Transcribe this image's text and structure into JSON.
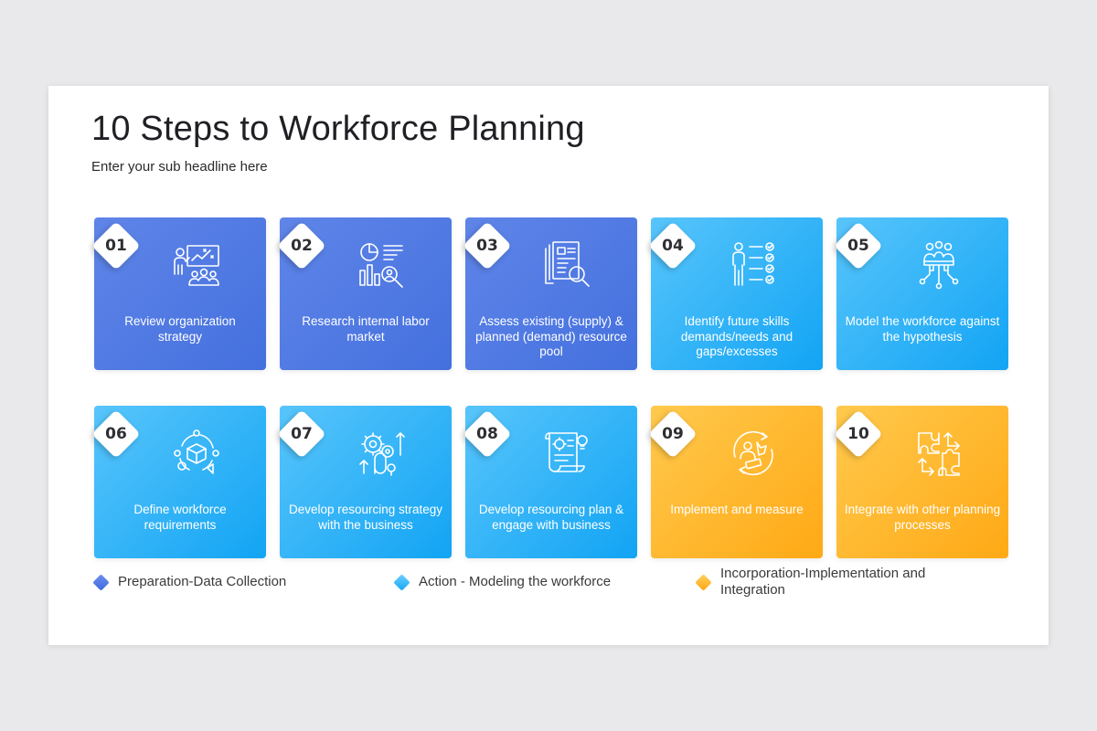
{
  "title": "10 Steps to Workforce Planning",
  "subtitle": "Enter your sub headline here",
  "colors": {
    "preparation": "#4e78e0",
    "action": "#2fb2f7",
    "integration": "#ffb020"
  },
  "steps": [
    {
      "number": "01",
      "label": "Review organization strategy",
      "category": "preparation",
      "icon": "strategy-presentation-icon"
    },
    {
      "number": "02",
      "label": "Research  internal labor market",
      "category": "preparation",
      "icon": "research-analytics-icon"
    },
    {
      "number": "03",
      "label": "Assess  existing (supply) & planned (demand) resource pool",
      "category": "preparation",
      "icon": "document-search-icon"
    },
    {
      "number": "04",
      "label": "Identify future skills demands/needs  and gaps/excesses",
      "category": "action",
      "icon": "person-checklist-icon"
    },
    {
      "number": "05",
      "label": "Model the workforce against the hypothesis",
      "category": "action",
      "icon": "team-network-icon"
    },
    {
      "number": "06",
      "label": "Define workforce requirements",
      "category": "action",
      "icon": "cube-cycle-icon"
    },
    {
      "number": "07",
      "label": "Develop resourcing strategy with the business",
      "category": "action",
      "icon": "gears-growth-icon"
    },
    {
      "number": "08",
      "label": "Develop resourcing plan & engage with business",
      "category": "action",
      "icon": "plan-scroll-icon"
    },
    {
      "number": "09",
      "label": "Implement and measure",
      "category": "integration",
      "icon": "implement-cycle-icon"
    },
    {
      "number": "10",
      "label": "Integrate with other planning processes",
      "category": "integration",
      "icon": "puzzle-icon"
    }
  ],
  "legend": [
    {
      "label": "Preparation-Data Collection",
      "category": "preparation"
    },
    {
      "label": "Action - Modeling the workforce",
      "category": "action"
    },
    {
      "label": "Incorporation-Implementation  and Integration",
      "category": "integration"
    }
  ]
}
